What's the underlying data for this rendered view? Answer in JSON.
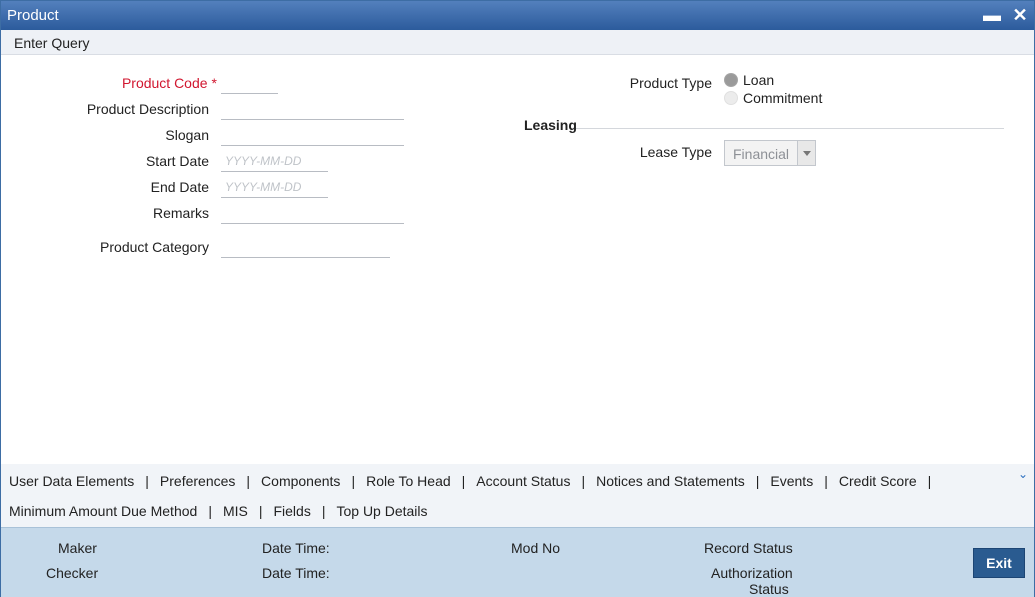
{
  "window": {
    "title": "Product",
    "minimize_glyph": "▬",
    "close_glyph": "✕"
  },
  "toolbar": {
    "enter_query": "Enter Query"
  },
  "form": {
    "product_code": {
      "label": "Product Code",
      "required_mark": "*",
      "value": ""
    },
    "product_description": {
      "label": "Product Description",
      "value": ""
    },
    "slogan": {
      "label": "Slogan",
      "value": ""
    },
    "start_date": {
      "label": "Start Date",
      "placeholder": "YYYY-MM-DD"
    },
    "end_date": {
      "label": "End Date",
      "placeholder": "YYYY-MM-DD"
    },
    "remarks": {
      "label": "Remarks",
      "value": ""
    },
    "product_category": {
      "label": "Product Category",
      "value": ""
    }
  },
  "product_type": {
    "label": "Product Type",
    "options": [
      {
        "label": "Loan",
        "selected": true
      },
      {
        "label": "Commitment",
        "selected": false
      }
    ]
  },
  "leasing": {
    "section_title": "Leasing",
    "lease_type_label": "Lease Type",
    "lease_type_value": "Financial"
  },
  "tabs": {
    "row1": [
      "User Data Elements",
      "Preferences",
      "Components",
      "Role To Head",
      "Account Status",
      "Notices and Statements",
      "Events",
      "Credit Score"
    ],
    "row2": [
      "Minimum Amount Due Method",
      "MIS",
      "Fields",
      "Top Up Details"
    ],
    "separator": "|"
  },
  "footer": {
    "maker": "Maker",
    "checker": "Checker",
    "date_time_1": "Date Time:",
    "date_time_2": "Date Time:",
    "mod_no": "Mod No",
    "record_status": "Record Status",
    "authorization": "Authorization",
    "status": "Status",
    "exit_label": "Exit"
  },
  "colors": {
    "titlebar": "#2c5b9c",
    "required": "#d1162f",
    "footer_bg": "#c5d9ea",
    "exit_button": "#2a5b90"
  }
}
